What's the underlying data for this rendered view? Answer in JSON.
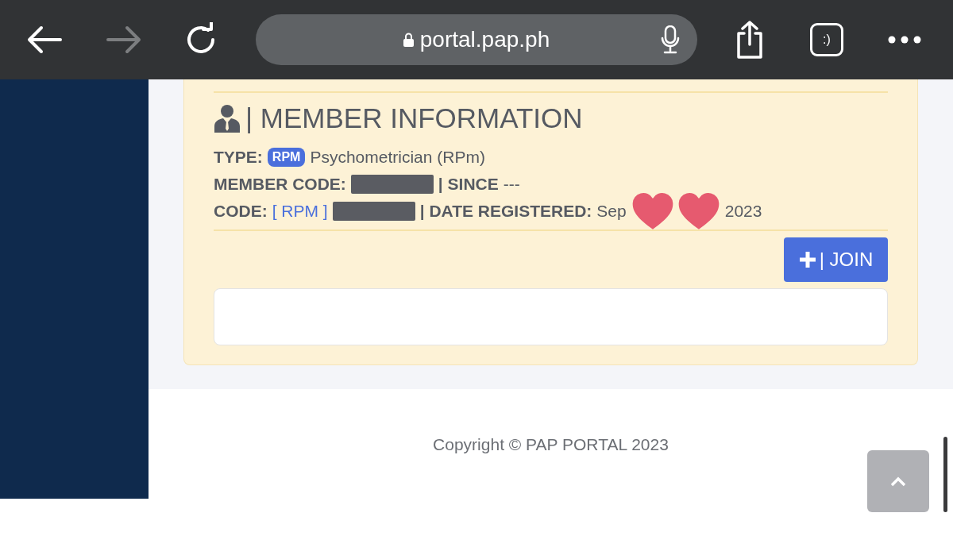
{
  "browser": {
    "url": "portal.pap.ph",
    "forward_disabled": true,
    "tab_label": ":)"
  },
  "member_card": {
    "title": "| MEMBER INFORMATION",
    "type_label": "TYPE:",
    "type_badge": "RPM",
    "type_value": "Psychometrician (RPm)",
    "member_code_label": "MEMBER CODE:",
    "since_label": "| SINCE",
    "since_value": "---",
    "code_label": "CODE:",
    "code_prefix": "[ RPM ]",
    "date_label": "| DATE REGISTERED:",
    "date_parts": [
      "Sep",
      "2023"
    ],
    "join_button": "| JOIN"
  },
  "footer": {
    "copyright": "Copyright © PAP PORTAL 2023"
  }
}
